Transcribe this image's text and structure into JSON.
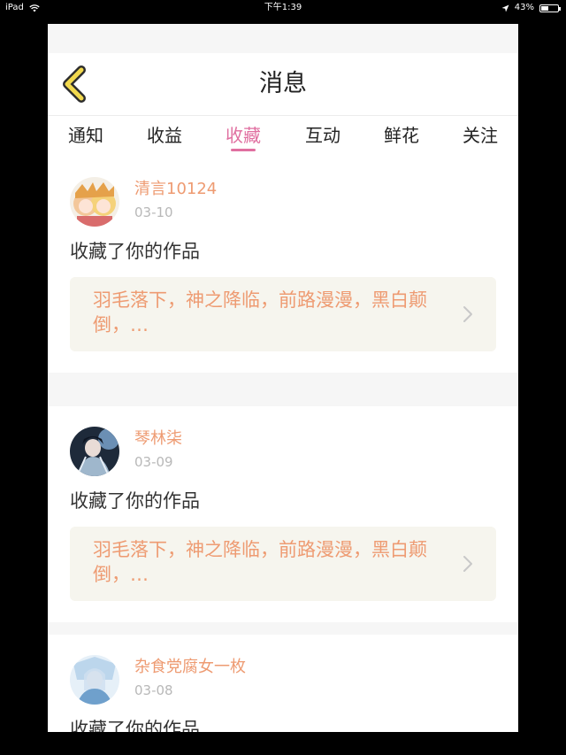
{
  "status_bar": {
    "device": "iPad",
    "time": "下午1:39",
    "battery": "43%",
    "battery_level": 0.43
  },
  "header": {
    "title": "消息",
    "back_icon": "chevron-left-icon"
  },
  "tabs": [
    {
      "label": "通知",
      "active": false
    },
    {
      "label": "收益",
      "active": false
    },
    {
      "label": "收藏",
      "active": true
    },
    {
      "label": "互动",
      "active": false
    },
    {
      "label": "鲜花",
      "active": false
    },
    {
      "label": "关注",
      "active": false
    }
  ],
  "notifications": [
    {
      "user": "清言10124",
      "date": "03-10",
      "action": "收藏了你的作品",
      "work": "羽毛落下，神之降临，前路漫漫，黑白颠倒，…"
    },
    {
      "user": "琴林柒",
      "date": "03-09",
      "action": "收藏了你的作品",
      "work": "羽毛落下，神之降临，前路漫漫，黑白颠倒，…"
    },
    {
      "user": "杂食党腐女一枚",
      "date": "03-08",
      "action": "收藏了你的作品",
      "work": ""
    }
  ],
  "colors": {
    "accent_pink": "#e06fa0",
    "name_orange": "#ee9b72",
    "back_icon_yellow": "#f2d94e"
  }
}
